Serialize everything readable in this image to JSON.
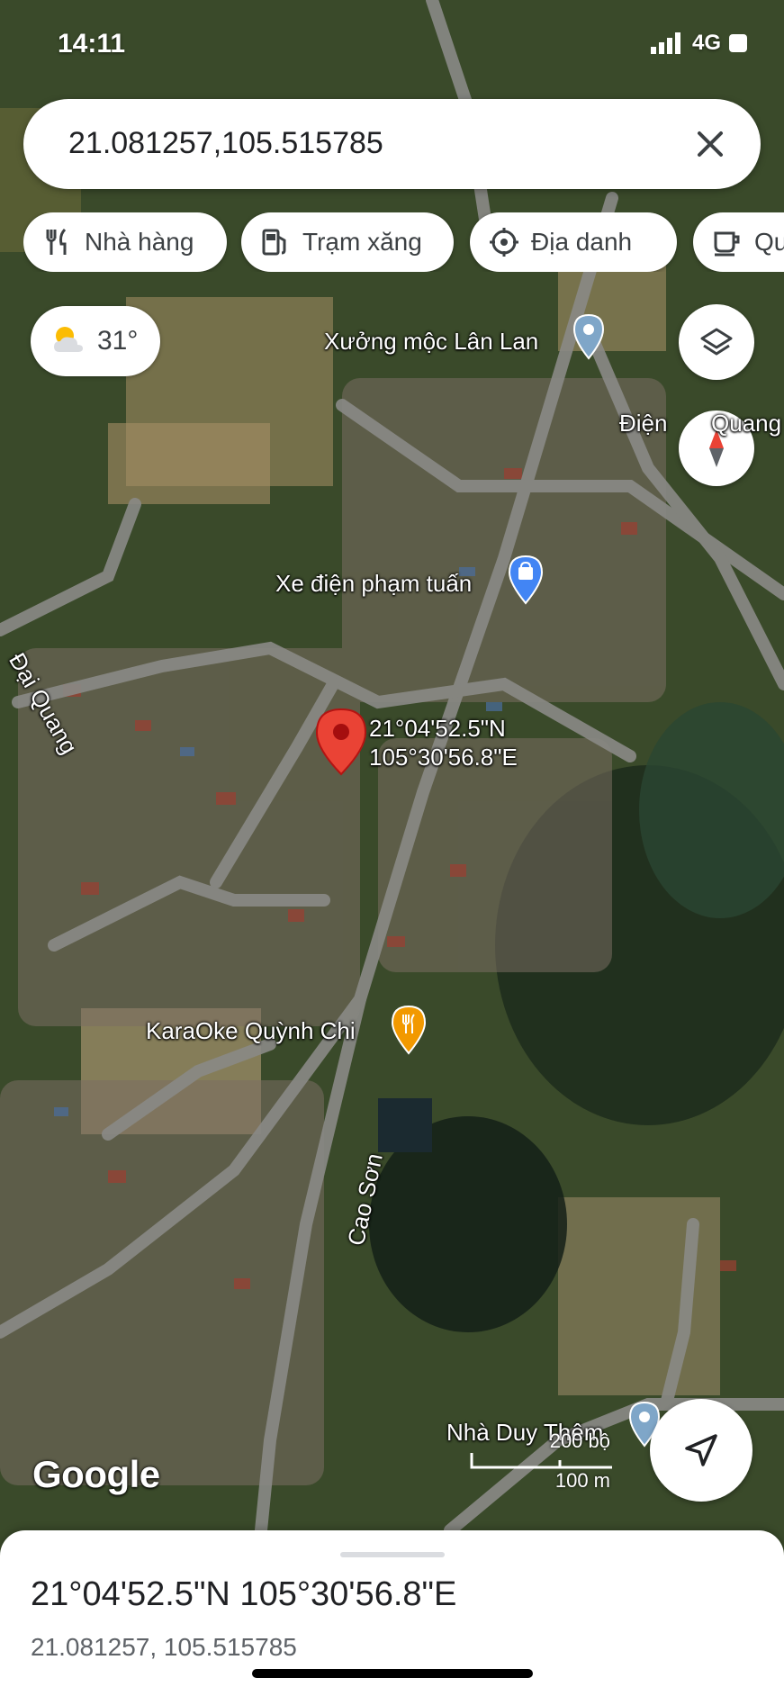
{
  "status_bar": {
    "time": "14:11",
    "network": "4G"
  },
  "search": {
    "query": "21.081257,105.515785"
  },
  "chips": [
    {
      "label": "Nhà hàng",
      "icon": "fork-knife-icon"
    },
    {
      "label": "Trạm xăng",
      "icon": "gas-station-icon"
    },
    {
      "label": "Địa danh",
      "icon": "landmark-icon"
    },
    {
      "label": "Quá",
      "icon": "coffee-cup-icon"
    }
  ],
  "weather": {
    "temperature": "31°",
    "icon": "partly-cloudy-icon"
  },
  "map_labels": {
    "xuong_moc": "Xưởng mộc Lân Lan",
    "dien": "Điện",
    "quang": "Quang",
    "xe_dien": "Xe điện phạm tuấn",
    "dai_quang": "Đại Quang",
    "karaoke": "KaraOke Quỳnh Chi",
    "cao_son": "Cao Sơn",
    "nha_duy": "Nhà Duy Thêm"
  },
  "pin": {
    "lat": "21°04'52.5\"N",
    "lng": "105°30'56.8\"E"
  },
  "scale": {
    "feet": "200 bộ",
    "meters": "100 m"
  },
  "attribution": "Google",
  "sheet": {
    "title": "21°04'52.5\"N 105°30'56.8\"E",
    "subtitle": "21.081257, 105.515785"
  },
  "colors": {
    "pin_red": "#ea4335",
    "karaoke_orange": "#f29900",
    "poi_blue": "#4285f4"
  }
}
